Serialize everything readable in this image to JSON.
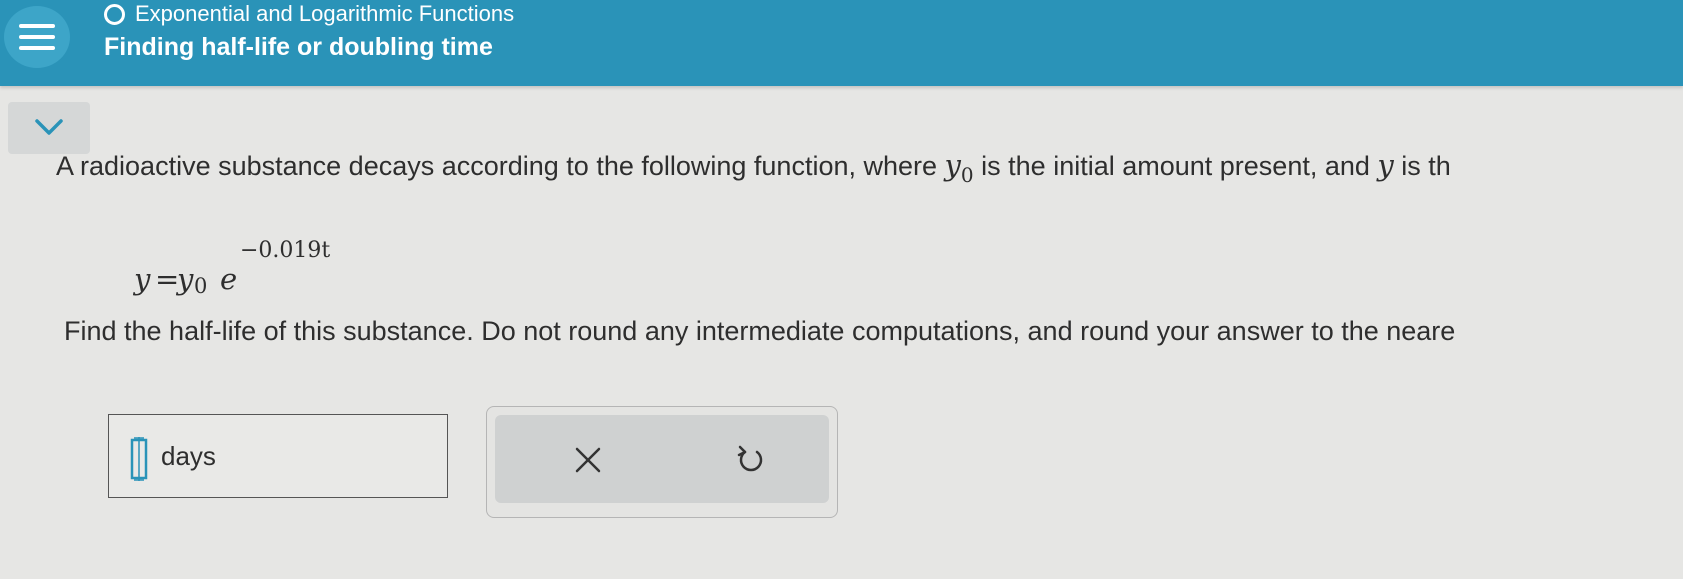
{
  "header": {
    "topic": "Exponential and Logarithmic Functions",
    "subtitle": "Finding half-life or doubling time",
    "icons": [
      "menu-icon",
      "topic-circle-icon"
    ]
  },
  "collapse_icon": "chevron-down-icon",
  "question": {
    "intro_before": "A radioactive substance decays according to the following function, where ",
    "var_y0_base": "y",
    "var_y0_sub": "0",
    "intro_middle": " is the initial amount present, and ",
    "var_y": "y",
    "intro_after": " is th",
    "formula": {
      "lhs": "y",
      "equals": "=",
      "y0_base": "y",
      "y0_sub": "0",
      "base": "e",
      "exponent": "−0.019t"
    },
    "instruction": "Find the half-life of this substance. Do not round any intermediate computations, and round your answer to the neare"
  },
  "answer": {
    "value": "",
    "unit": "days"
  },
  "actions": {
    "clear_icon": "close-icon",
    "undo_icon": "undo-icon"
  },
  "colors": {
    "header_bg": "#2a93b8",
    "page_bg": "#e6e6e4",
    "button_bg": "#cfd1d1"
  }
}
